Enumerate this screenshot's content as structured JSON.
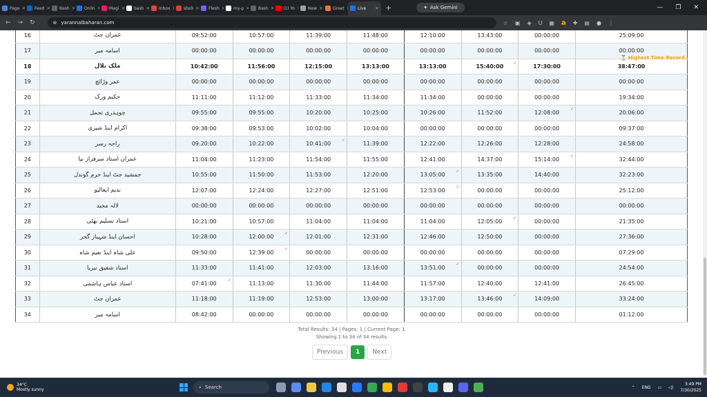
{
  "browser": {
    "tabs": [
      {
        "label": "Page",
        "color": "#4285f4"
      },
      {
        "label": "Feed",
        "color": "#0a66c2"
      },
      {
        "label": "Bash",
        "color": "#5f6368"
      },
      {
        "label": "Onlin",
        "color": "#1a73e8"
      },
      {
        "label": "Magi",
        "color": "#e91e63"
      },
      {
        "label": "bash",
        "color": "#ffffff"
      },
      {
        "label": "Inbox",
        "color": "#ea4335"
      },
      {
        "label": "sbs9",
        "color": "#e53935"
      },
      {
        "label": "Flesh",
        "color": "#7b61ff"
      },
      {
        "label": "my-p",
        "color": "#ffffff"
      },
      {
        "label": "Bash",
        "color": "#5f6368"
      },
      {
        "label": "(1) Yo",
        "color": "#ff0000"
      },
      {
        "label": "New",
        "color": "#9aa0a6"
      },
      {
        "label": "Greet",
        "color": "#ff7043"
      },
      {
        "label": "Live",
        "color": "#1a73e8"
      }
    ],
    "ask_gemini": "Ask Gemini",
    "url": "yarannalbaharan.com"
  },
  "table": {
    "badge": "Highest Time Record",
    "rows": [
      {
        "n": "16",
        "name": "عمران جٹ",
        "t": [
          "09:52:00",
          "10:57:00",
          "11:39:00",
          "11:48:00",
          "12:10:00",
          "13:43:00",
          "00:00:00"
        ],
        "total": "25:09:00",
        "bold": false
      },
      {
        "n": "17",
        "name": "اسامہ میر",
        "t": [
          "00:00:00",
          "00:00:00",
          "00:00:00",
          "00:00:00",
          "00:00:00",
          "00:00:00",
          "00:00:00"
        ],
        "total": "00:00:00",
        "bold": false
      },
      {
        "n": "18",
        "name": "ملک بلال",
        "t": [
          "10:42:00",
          "11:56:00",
          "12:15:00",
          "13:13:00",
          "13:13:00",
          "15:40:00",
          "17:30:00"
        ],
        "total": "38:47:00",
        "bold": true
      },
      {
        "n": "19",
        "name": "عمر وڑائچ",
        "t": [
          "00:00:00",
          "00:00:00",
          "00:00:00",
          "00:00:00",
          "00:00:00",
          "00:00:00",
          "00:00:00"
        ],
        "total": "00:00:00",
        "bold": false
      },
      {
        "n": "20",
        "name": "حکیم ورک",
        "t": [
          "11:11:00",
          "11:12:00",
          "11:33:00",
          "11:34:00",
          "11:34:00",
          "00:00:00",
          "00:00:00"
        ],
        "total": "19:34:00",
        "bold": false
      },
      {
        "n": "21",
        "name": "چوہدری تجمل",
        "t": [
          "09:55:00",
          "09:55:00",
          "10:20:00",
          "10:25:00",
          "10:26:00",
          "11:52:00",
          "12:08:00"
        ],
        "total": "20:06:00",
        "bold": false
      },
      {
        "n": "22",
        "name": "اکرام اینڈ شیری",
        "t": [
          "09:38:00",
          "09:53:00",
          "10:02:00",
          "10:04:00",
          "00:00:00",
          "00:00:00",
          "00:00:00"
        ],
        "total": "09:37:00",
        "bold": false
      },
      {
        "n": "23",
        "name": "راجہ رسر",
        "t": [
          "09:20:00",
          "10:22:00",
          "10:41:00",
          "11:39:00",
          "12:22:00",
          "12:26:00",
          "12:28:00"
        ],
        "total": "24:58:00",
        "bold": false
      },
      {
        "n": "24",
        "name": "عمران استاد سرفراز نیا",
        "t": [
          "11:04:00",
          "11:23:00",
          "11:54:00",
          "11:55:00",
          "12:41:00",
          "14:37:00",
          "15:14:00"
        ],
        "total": "32:44:00",
        "bold": false
      },
      {
        "n": "25",
        "name": "جمشید جٹ اینڈ حرم گوندل",
        "t": [
          "10:55:00",
          "11:50:00",
          "11:53:00",
          "12:20:00",
          "13:05:00",
          "13:35:00",
          "14:40:00"
        ],
        "total": "32:23:00",
        "bold": false
      },
      {
        "n": "26",
        "name": "ندیم ایعالیو",
        "t": [
          "12:07:00",
          "12:24:00",
          "12:27:00",
          "12:51:00",
          "12:53:00",
          "00:00:00",
          "00:00:00"
        ],
        "total": "25:12:00",
        "bold": false
      },
      {
        "n": "27",
        "name": "لالہ مجید",
        "t": [
          "00:00:00",
          "00:00:00",
          "00:00:00",
          "00:00:00",
          "00:00:00",
          "00:00:00",
          "00:00:00"
        ],
        "total": "00:00:00",
        "bold": false
      },
      {
        "n": "28",
        "name": "استاد تسلیم بھٹی",
        "t": [
          "10:21:00",
          "10:57:00",
          "11:04:00",
          "11:04:00",
          "11:04:00",
          "12:05:00",
          "00:00:00"
        ],
        "total": "21:35:00",
        "bold": false
      },
      {
        "n": "29",
        "name": "احسان اینڈ شہباز گجر",
        "t": [
          "10:28:00",
          "12:00:00",
          "12:01:00",
          "12:31:00",
          "12:46:00",
          "12:50:00",
          "00:00:00"
        ],
        "total": "27:36:00",
        "bold": false
      },
      {
        "n": "30",
        "name": "علی شاہ اینڈ نعیم شاہ",
        "t": [
          "09:50:00",
          "12:39:00",
          "00:00:00",
          "00:00:00",
          "00:00:00",
          "00:00:00",
          "00:00:00"
        ],
        "total": "07:29:00",
        "bold": false
      },
      {
        "n": "31",
        "name": "استاد شفیق نیریا",
        "t": [
          "11:33:00",
          "11:41:00",
          "12:03:00",
          "13:16:00",
          "13:51:00",
          "00:00:00",
          "00:00:00"
        ],
        "total": "24:54:00",
        "bold": false
      },
      {
        "n": "32",
        "name": "استاد عباس ہاشمی",
        "t": [
          "07:41:00",
          "11:13:00",
          "11:30:00",
          "11:44:00",
          "11:57:00",
          "12:40:00",
          "12:41:00"
        ],
        "total": "26:45:00",
        "bold": false
      },
      {
        "n": "33",
        "name": "عمران جٹ",
        "t": [
          "11:18:00",
          "11:19:00",
          "12:53:00",
          "13:00:00",
          "13:17:00",
          "13:46:00",
          "14:09:00"
        ],
        "total": "33:24:00",
        "bold": false
      },
      {
        "n": "34",
        "name": "اسامہ میر",
        "t": [
          "08:42:00",
          "00:00:00",
          "00:00:00",
          "00:00:00",
          "00:00:00",
          "00:00:00",
          "00:00:00"
        ],
        "total": "01:12:00",
        "bold": false
      }
    ]
  },
  "results": {
    "summary": "Total Results: 34 | Pages: 1 | Current Page: 1",
    "showing": "Showing 1 to 34 of 34 results"
  },
  "pagination": {
    "previous": "Previous",
    "current": "1",
    "next": "Next"
  },
  "taskbar": {
    "temp": "34°C",
    "weather": "Mostly sunny",
    "search": "Search",
    "lang": "ENG",
    "time": "3:49 PM",
    "date": "7/30/2025"
  }
}
